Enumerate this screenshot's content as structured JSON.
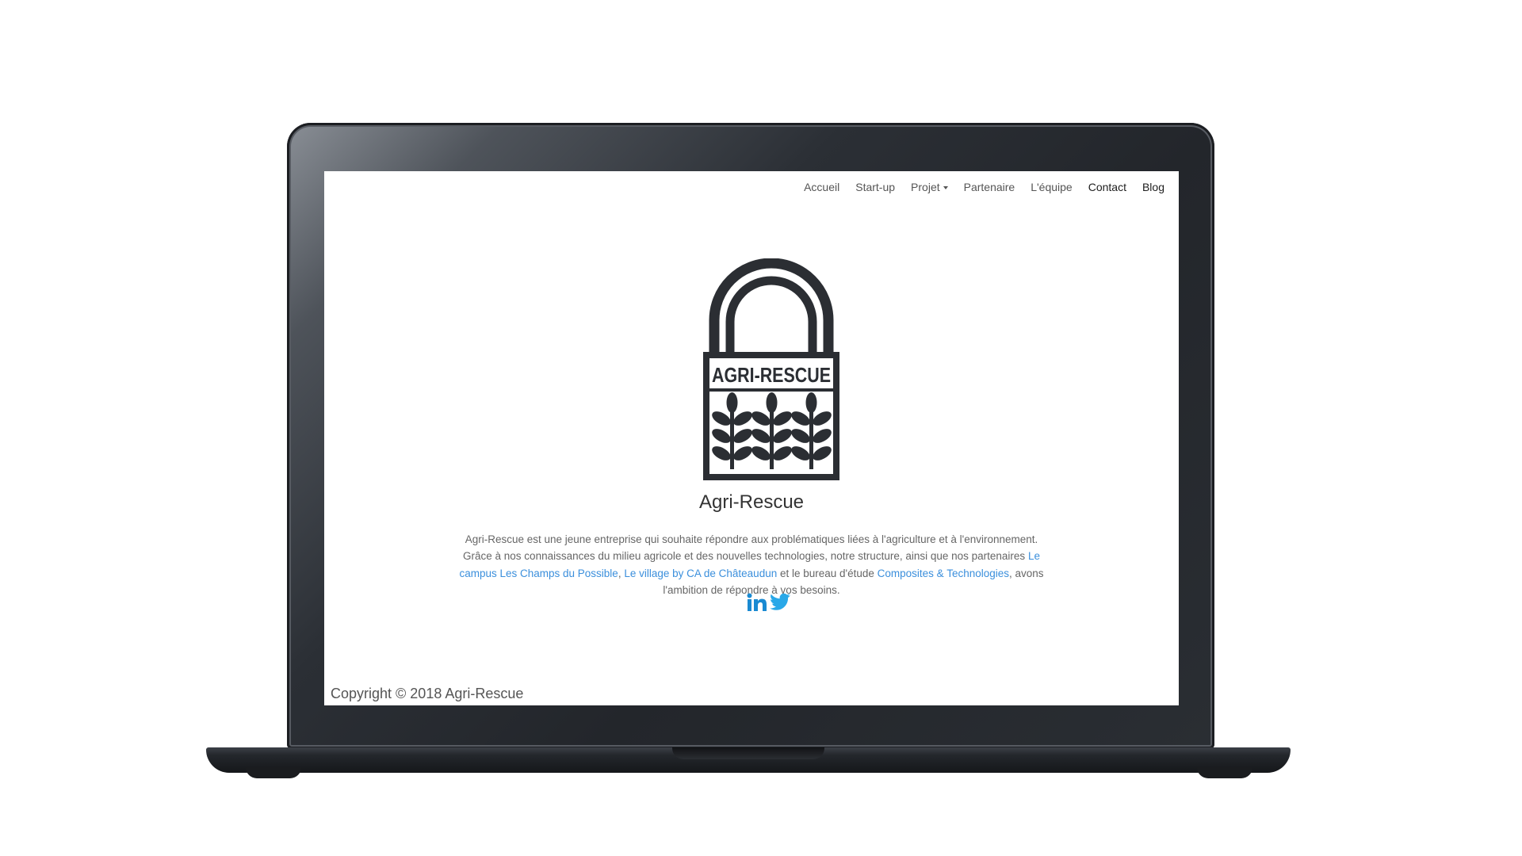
{
  "nav": {
    "items": [
      {
        "label": "Accueil"
      },
      {
        "label": "Start-up"
      },
      {
        "label": "Projet"
      },
      {
        "label": "Partenaire"
      },
      {
        "label": "L'équipe"
      },
      {
        "label": "Contact"
      },
      {
        "label": "Blog"
      }
    ]
  },
  "logo": {
    "text": "AGRI-RESCUE"
  },
  "main": {
    "title": "Agri-Rescue",
    "description": {
      "intro": "Agri-Rescue est une jeune entreprise qui souhaite répondre aux problématiques liées à l'agriculture et à l'environnement. Grâce à nos connaissances du milieu agricole et des nouvelles technologies, notre structure, ainsi que nos partenaires ",
      "link1": "Le campus Les Champs du Possible",
      "sep1": ", ",
      "link2": "Le village by CA de Châteaudun",
      "sep2": " et le bureau d'étude ",
      "link3": "Composites & Technologies",
      "outro": ", avons l'ambition de répondre à vos besoins."
    }
  },
  "social": {
    "linkedin_icon": "linkedin-icon",
    "twitter_icon": "twitter-icon"
  },
  "footer": {
    "copyright": "Copyright © 2018 Agri-Rescue"
  },
  "colors": {
    "link": "#3b8fdc",
    "linkedin": "#1a8ad2",
    "twitter": "#29a8e8",
    "logo": "#2b2e33"
  }
}
